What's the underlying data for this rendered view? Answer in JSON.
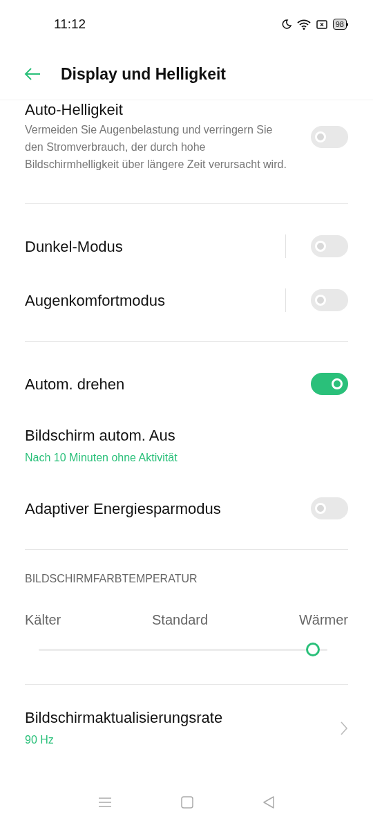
{
  "status_bar": {
    "time": "11:12",
    "battery": "98"
  },
  "header": {
    "title": "Display und Helligkeit"
  },
  "sections": [
    {
      "kind": "list",
      "items": [
        {
          "kind": "toggle",
          "title": "Auto-Helligkeit",
          "description": "Vermeiden Sie Augenbelastung und verringern Sie den Stromverbrauch, der durch hohe Bildschirmhelligkeit über längere Zeit verursacht wird.",
          "on": false,
          "separator": false
        }
      ]
    },
    {
      "kind": "list",
      "items": [
        {
          "kind": "toggle",
          "title": "Dunkel-Modus",
          "on": false,
          "separator": true
        },
        {
          "kind": "toggle",
          "title": "Augenkomfortmodus",
          "on": false,
          "separator": true
        }
      ]
    },
    {
      "kind": "list",
      "items": [
        {
          "kind": "toggle",
          "title": "Autom. drehen",
          "on": true,
          "separator": false
        },
        {
          "kind": "value",
          "title": "Bildschirm autom. Aus",
          "value": "Nach 10 Minuten ohne Aktivität"
        },
        {
          "kind": "toggle",
          "title": "Adaptiver Energiesparmodus",
          "on": false,
          "separator": false
        }
      ]
    },
    {
      "kind": "slider",
      "heading": "BILDSCHIRMFARBTEMPERATUR",
      "labels": [
        "Kälter",
        "Standard",
        "Wärmer"
      ],
      "level": 0.95
    },
    {
      "kind": "list",
      "items": [
        {
          "kind": "link",
          "title": "Bildschirmaktualisierungsrate",
          "value": "90 Hz"
        }
      ]
    }
  ]
}
